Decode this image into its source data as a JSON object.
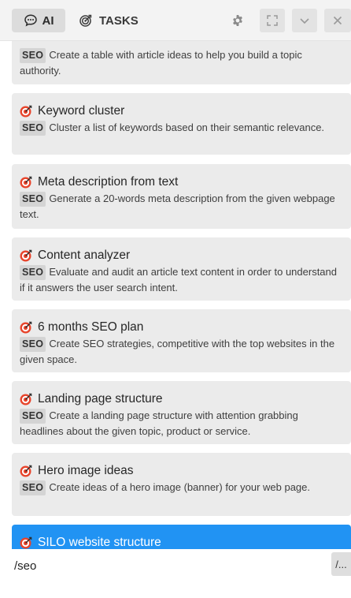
{
  "header": {
    "ai_tab_label": "AI",
    "tasks_tab_label": "TASKS"
  },
  "tag_label": "SEO",
  "items": [
    {
      "title": "",
      "description": "Create a table with article ideas to help you build a topic authority."
    },
    {
      "title": "Keyword cluster",
      "description": "Cluster a list of keywords based on their semantic relevance."
    },
    {
      "title": "Meta description from text",
      "description": "Generate a 20-words meta description from the given webpage text."
    },
    {
      "title": "Content analyzer",
      "description": "Evaluate and audit an article text content in order to understand if it answers the user search intent."
    },
    {
      "title": "6 months SEO plan",
      "description": "Create SEO strategies, competitive with the top websites in the given space."
    },
    {
      "title": "Landing page structure",
      "description": "Create a landing page structure with attention grabbing headlines about the given topic, product or service."
    },
    {
      "title": "Hero image ideas",
      "description": "Create ideas of a hero image (banner) for your web page."
    },
    {
      "title": "SILO website structure",
      "description": ""
    }
  ],
  "input": {
    "value": "/seo"
  },
  "slash_button_label": "/...",
  "colors": {
    "selected": "#2193f3",
    "card_bg": "#ebebeb",
    "icon_red": "#e8452c"
  }
}
